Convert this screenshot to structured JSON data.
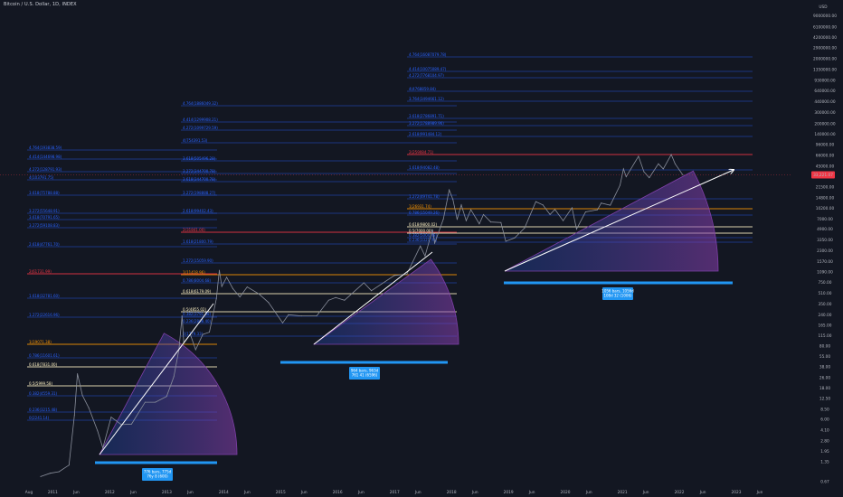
{
  "header": {
    "title": "Bitcoin / U.S. Dollar, 1D, INDEX"
  },
  "colors": {
    "background": "#131722",
    "fib_blue": "#2962ff",
    "fib_red": "#f23645",
    "fib_orange": "#ff9800",
    "fib_cream": "#fff3c4",
    "price_line": "#8a8f9c",
    "arrow": "#ffffff",
    "bar": "#2196f3",
    "arc_purple": "#7e3fa8"
  },
  "chart_data": {
    "type": "line",
    "title": "Bitcoin / U.S. Dollar, 1D, INDEX",
    "y_scale": "log",
    "y_unit": "USD",
    "ylim": [
      0.67,
      12200000
    ],
    "xlim": [
      "2010-07-15",
      "2023-09-01"
    ],
    "x_ticks": [
      "Aug",
      "2011",
      "Jun",
      "2012",
      "Jun",
      "2013",
      "Jun",
      "2014",
      "Jun",
      "2015",
      "Jun",
      "2016",
      "Jun",
      "2017",
      "Jun",
      "2018",
      "Jun",
      "2019",
      "Jun",
      "2020",
      "Jun",
      "2021",
      "Jun",
      "2022",
      "Jun",
      "2023",
      "Jun"
    ],
    "x_tick_dates": [
      "2010-08-01",
      "2011-01-01",
      "2011-06-01",
      "2012-01-01",
      "2012-06-01",
      "2013-01-01",
      "2013-06-01",
      "2014-01-01",
      "2014-06-01",
      "2015-01-01",
      "2015-06-01",
      "2016-01-01",
      "2016-06-01",
      "2017-01-01",
      "2017-06-01",
      "2018-01-01",
      "2018-06-01",
      "2019-01-01",
      "2019-06-01",
      "2020-01-01",
      "2020-06-01",
      "2021-01-01",
      "2021-06-01",
      "2022-01-01",
      "2022-06-01",
      "2023-01-01",
      "2023-06-01"
    ],
    "y_ticks": [
      0.67,
      1.35,
      1.95,
      2.8,
      4.1,
      6.0,
      8.5,
      12.5,
      18.0,
      26.0,
      38.0,
      55.0,
      80.0,
      115.0,
      165.0,
      240.0,
      350.0,
      510.0,
      750.0,
      1090.0,
      1570.0,
      2300.0,
      3350.0,
      4900.0,
      7000.0,
      10200.0,
      14800.0,
      21500.0,
      31000.0,
      45000.0,
      66000.0,
      96000.0,
      140000.0,
      200000.0,
      300000.0,
      440000.0,
      640000.0,
      930000.0,
      1350000.0,
      2000000.0,
      2900000.0,
      4200000.0,
      6100000.0,
      9000000.0,
      12200000.0
    ],
    "y_tick_labels": [
      "0.67",
      "1.35",
      "1.95",
      "2.80",
      "4.10",
      "6.00",
      "8.50",
      "12.50",
      "18.00",
      "26.00",
      "38.00",
      "55.00",
      "80.00",
      "115.00",
      "165.00",
      "240.00",
      "350.00",
      "510.00",
      "750.00",
      "1090.00",
      "1570.00",
      "2300.00",
      "3350.00",
      "4900.00",
      "7000.00",
      "10200.00",
      "14800.00",
      "21500.00",
      "31000.00",
      "45000.00",
      "66000.00",
      "96000.00",
      "140000.00",
      "200000.00",
      "300000.00",
      "440000.00",
      "640000.00",
      "930000.00",
      "1350000.00",
      "2000000.00",
      "2900000.00",
      "4200000.00",
      "6100000.00",
      "9000000.00",
      "12200000.00"
    ],
    "axis_unit_label": "USD",
    "current_price_label": "33,221.07",
    "current_price": 33221.07,
    "series": [
      {
        "values": [
          [
            "2010-10-15",
            0.8
          ],
          [
            "2010-12-15",
            0.9
          ],
          [
            "2011-02-10",
            0.95
          ],
          [
            "2011-04-15",
            1.2
          ],
          [
            "2011-05-20",
            7
          ],
          [
            "2011-06-08",
            30
          ],
          [
            "2011-07-10",
            14
          ],
          [
            "2011-08-20",
            9
          ],
          [
            "2011-10-15",
            4
          ],
          [
            "2011-11-18",
            2.2
          ],
          [
            "2012-01-10",
            6.5
          ],
          [
            "2012-03-15",
            5
          ],
          [
            "2012-05-20",
            5.1
          ],
          [
            "2012-08-15",
            11
          ],
          [
            "2012-10-20",
            11
          ],
          [
            "2012-12-31",
            13.5
          ],
          [
            "2013-02-15",
            27
          ],
          [
            "2013-03-20",
            70
          ],
          [
            "2013-04-09",
            230
          ],
          [
            "2013-04-20",
            90
          ],
          [
            "2013-06-01",
            120
          ],
          [
            "2013-07-05",
            70
          ],
          [
            "2013-08-20",
            120
          ],
          [
            "2013-10-01",
            130
          ],
          [
            "2013-11-15",
            420
          ],
          [
            "2013-12-04",
            1150
          ],
          [
            "2013-12-20",
            650
          ],
          [
            "2014-01-20",
            900
          ],
          [
            "2014-03-01",
            600
          ],
          [
            "2014-04-15",
            450
          ],
          [
            "2014-06-01",
            640
          ],
          [
            "2014-08-15",
            500
          ],
          [
            "2014-10-15",
            370
          ],
          [
            "2015-01-14",
            180
          ],
          [
            "2015-02-20",
            240
          ],
          [
            "2015-05-15",
            230
          ],
          [
            "2015-08-20",
            230
          ],
          [
            "2015-11-05",
            400
          ],
          [
            "2015-12-20",
            440
          ],
          [
            "2016-02-15",
            400
          ],
          [
            "2016-06-18",
            740
          ],
          [
            "2016-08-05",
            560
          ],
          [
            "2016-12-31",
            960
          ],
          [
            "2017-03-20",
            1000
          ],
          [
            "2017-06-15",
            2700
          ],
          [
            "2017-07-15",
            1900
          ],
          [
            "2017-09-01",
            4800
          ],
          [
            "2017-09-15",
            3000
          ],
          [
            "2017-11-10",
            7000
          ],
          [
            "2017-12-17",
            19500
          ],
          [
            "2018-01-10",
            14000
          ],
          [
            "2018-02-06",
            6900
          ],
          [
            "2018-03-05",
            11500
          ],
          [
            "2018-04-05",
            6600
          ],
          [
            "2018-05-05",
            9700
          ],
          [
            "2018-06-28",
            5900
          ],
          [
            "2018-07-25",
            8200
          ],
          [
            "2018-09-10",
            6300
          ],
          [
            "2018-11-14",
            6200
          ],
          [
            "2018-12-15",
            3200
          ],
          [
            "2019-02-10",
            3600
          ],
          [
            "2019-04-15",
            5100
          ],
          [
            "2019-06-26",
            12900
          ],
          [
            "2019-08-10",
            11500
          ],
          [
            "2019-09-25",
            8200
          ],
          [
            "2019-10-26",
            9800
          ],
          [
            "2019-12-18",
            6600
          ],
          [
            "2020-02-13",
            10400
          ],
          [
            "2020-03-13",
            4900
          ],
          [
            "2020-05-10",
            9000
          ],
          [
            "2020-07-25",
            9700
          ],
          [
            "2020-08-18",
            12300
          ],
          [
            "2020-10-15",
            11400
          ],
          [
            "2020-12-17",
            23000
          ],
          [
            "2021-01-08",
            41000
          ],
          [
            "2021-01-25",
            31000
          ],
          [
            "2021-04-14",
            64000
          ],
          [
            "2021-05-19",
            37000
          ],
          [
            "2021-06-22",
            30000
          ],
          [
            "2021-08-20",
            49000
          ],
          [
            "2021-09-20",
            41000
          ],
          [
            "2021-11-10",
            68000
          ],
          [
            "2021-12-05",
            49000
          ],
          [
            "2022-01-24",
            33000
          ]
        ]
      }
    ],
    "fib_labels": [
      "4.764(193838.59)",
      "4.414(144698.98)",
      "4.272(128791.93)",
      "4(103791.75)",
      "3.618(75788.88)",
      "3.272(55648.91)",
      "3.618(70791.65)",
      "3.272(59108.83)",
      "2.618(47761.70)",
      "2(61731.99)",
      "1.618(32781.60)",
      "1.272(22616.96)",
      "1(19071.38)",
      "0.786(11601.61)",
      "0.618(7831.00)",
      "0.5(5999.58)",
      "0.382(4559.31)",
      "0.236(3215.48)",
      "0(2241.14)",
      "4.764(1886049.32)",
      "4.414(1299908.21)",
      "4.272(1099729.59)",
      "4(754391.53)",
      "3.618(505496.28)",
      "3.272(344700.78)",
      "3.618(344700.78)",
      "3.272(198888.27)",
      "2.618(99402.43)",
      "2(31841.00)",
      "1.618(21800.79)",
      "1.272(15059.90)",
      "1(11418.96)",
      "0.786(8004.68)",
      "0.618(6179.09)",
      "0.5(4855.02)",
      "0.382(3791.88)",
      "0.236(2808.40)",
      "0(1779.33)",
      "4.764(16087079.78)",
      "4.414(10075089.47)",
      "4.272(7768104.97)",
      "4(4768859.84)",
      "3.764(3494661.12)",
      "3.618(2786891.71)",
      "3.272(1788989.96)",
      "2.618(991484.12)",
      "2(259084.71)",
      "1.618(94082.48)",
      "1.272(49741.78)",
      "1(26931.74)",
      "0.786(15049.26)",
      "0.618(9800.02)",
      "0.5(7000.00)",
      "0.382(5004.48)",
      "0.236(3321.98)"
    ],
    "annotations": [
      "776 bars, 775d\n76y 8 (600)",
      "964 bars, 963d\n761 41 (6596)",
      "1056 bars, 1056d\n108d 32 (1006)"
    ]
  }
}
